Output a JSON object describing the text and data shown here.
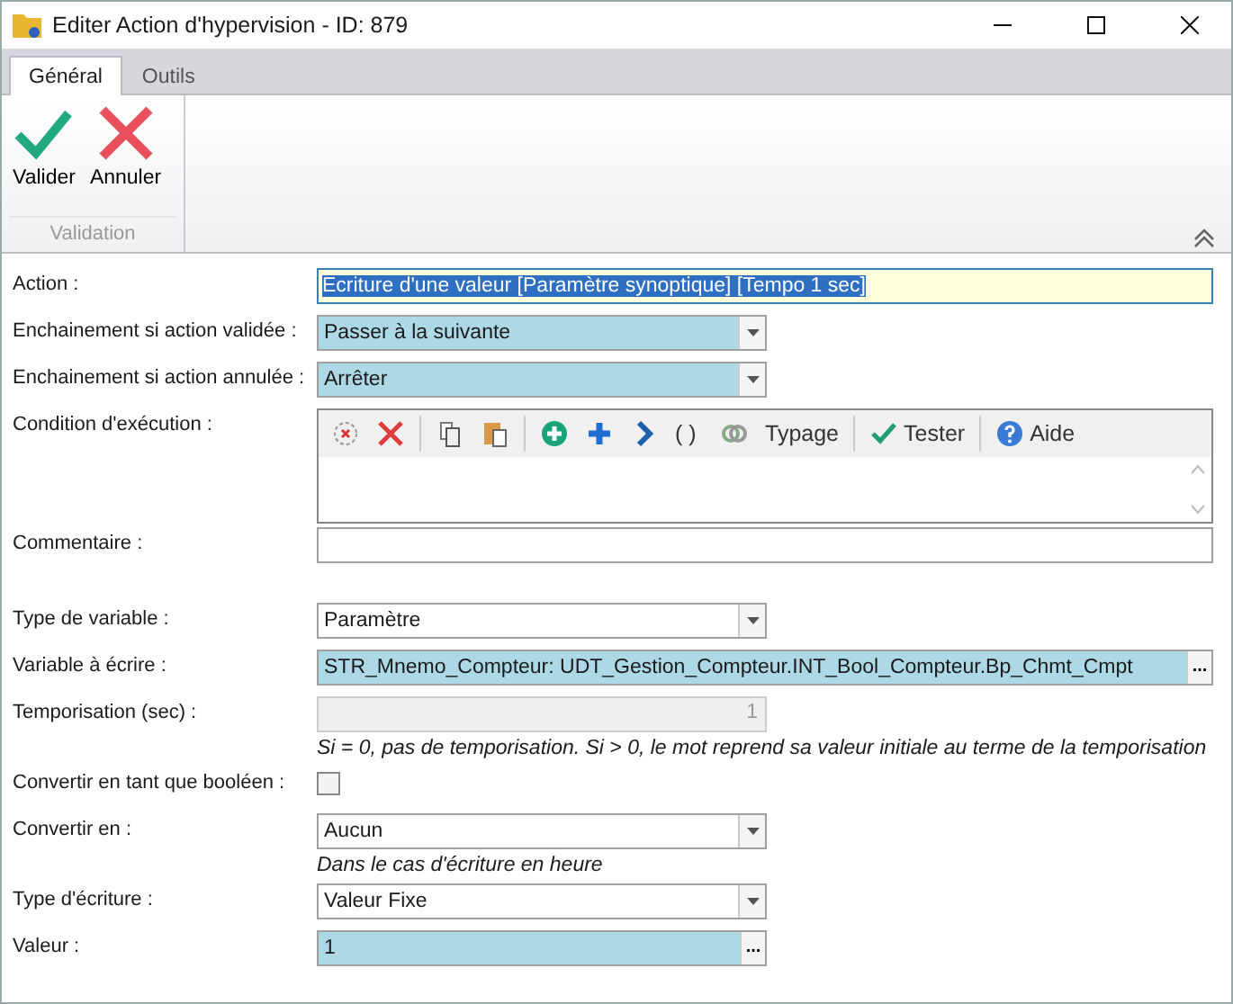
{
  "window": {
    "title": "Editer Action d'hypervision - ID: 879"
  },
  "tabs": [
    {
      "label": "Général",
      "selected": true
    },
    {
      "label": "Outils",
      "selected": false
    }
  ],
  "ribbon": {
    "buttons": [
      {
        "label": "Valider"
      },
      {
        "label": "Annuler"
      }
    ],
    "group": "Validation"
  },
  "sections": [
    [
      {
        "label": "Action :",
        "kind": "text",
        "value": "Ecriture d'une valeur [Paramètre synoptique] [Tempo 1 sec]",
        "focused": true
      },
      {
        "label": "Enchainement si action validée :",
        "kind": "combo",
        "value": "Passer à la suivante",
        "highlighted": true
      },
      {
        "label": "Enchainement si action annulée :",
        "kind": "combo",
        "value": "Arrêter",
        "highlighted": true
      },
      {
        "label": "Condition d'exécution :",
        "kind": "editor",
        "toolbar": [
          "( )",
          "Typage",
          "Tester",
          "Aide"
        ]
      },
      {
        "label": "Commentaire :",
        "kind": "text",
        "focused": false
      }
    ],
    [
      {
        "label": "Type de variable :",
        "kind": "combo",
        "value": "Paramètre",
        "highlighted": false
      },
      {
        "label": "Variable à écrire :",
        "kind": "picker",
        "value": "STR_Mnemo_Compteur: UDT_Gestion_Compteur.INT_Bool_Compteur.Bp_Chmt_Cmpt",
        "browse": "...",
        "wide": true
      },
      {
        "label": "Temporisation (sec) :",
        "kind": "number",
        "value": "1",
        "disabled": true,
        "hint": "Si = 0, pas de temporisation. Si > 0, le mot reprend sa valeur initiale au terme de la temporisation"
      },
      {
        "label": "Convertir en tant que booléen :",
        "kind": "checkbox",
        "checked": false
      },
      {
        "label": "Convertir en :",
        "kind": "combo",
        "value": "Aucun",
        "highlighted": false,
        "hint": "Dans le cas d'écriture en heure"
      },
      {
        "label": "Type d'écriture :",
        "kind": "combo",
        "value": "Valeur Fixe",
        "highlighted": false
      },
      {
        "label": "Valeur :",
        "kind": "picker",
        "value": "1",
        "browse": "...",
        "wide": false
      }
    ]
  ]
}
